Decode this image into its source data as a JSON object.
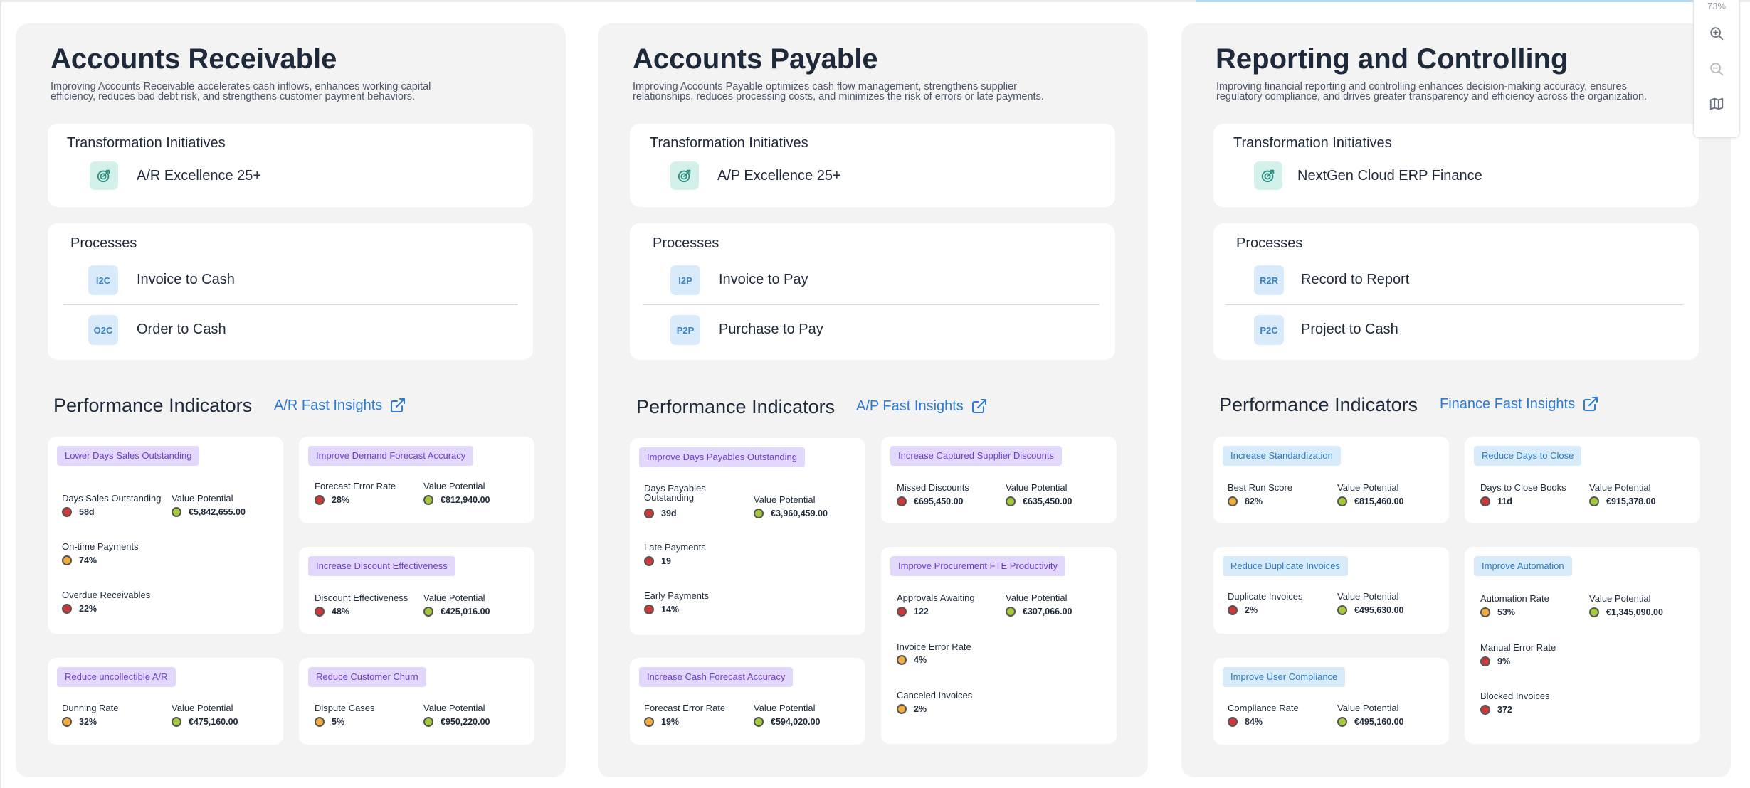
{
  "zoom": {
    "percent": "73%"
  },
  "columns": [
    {
      "title": "Accounts Receivable",
      "description_line1": "Improving Accounts Receivable accelerates cash inflows, enhances working capital",
      "description_line2": "efficiency, reduces bad debt risk, and strengthens customer payment behaviors.",
      "initiatives_title": "Transformation Initiatives",
      "initiative": "A/R Excellence 25+",
      "processes_title": "Processes",
      "processes": [
        {
          "code": "I2C",
          "name": "Invoice to Cash"
        },
        {
          "code": "O2C",
          "name": "Order to Cash"
        }
      ],
      "pi_title": "Performance Indicators",
      "pi_link": "A/R Fast Insights",
      "kpi_cards": [
        {
          "tag": "Lower Days Sales Outstanding",
          "value_label": "Value Potential",
          "value": "€5,842,655.00",
          "value_status": "green",
          "metrics": [
            {
              "label": "Days Sales Outstanding",
              "value": "58d",
              "status": "red"
            },
            {
              "label": "On-time Payments",
              "value": "74%",
              "status": "orange"
            },
            {
              "label": "Overdue Receivables",
              "value": "22%",
              "status": "red"
            }
          ]
        },
        {
          "tag": "Improve Demand Forecast Accuracy",
          "value_label": "Value Potential",
          "value": "€812,940.00",
          "value_status": "green",
          "metrics": [
            {
              "label": "Forecast Error Rate",
              "value": "28%",
              "status": "red"
            }
          ]
        },
        {
          "tag": "Increase Discount Effectiveness",
          "value_label": "Value Potential",
          "value": "€425,016.00",
          "value_status": "green",
          "metrics": [
            {
              "label": "Discount Effectiveness",
              "value": "48%",
              "status": "red"
            }
          ]
        },
        {
          "tag": "Reduce uncollectible A/R",
          "value_label": "Value Potential",
          "value": "€475,160.00",
          "value_status": "green",
          "metrics": [
            {
              "label": "Dunning Rate",
              "value": "32%",
              "status": "orange"
            }
          ]
        },
        {
          "tag": "Reduce Customer Churn",
          "value_label": "Value Potential",
          "value": "€950,220.00",
          "value_status": "green",
          "metrics": [
            {
              "label": "Dispute Cases",
              "value": "5%",
              "status": "orange"
            }
          ]
        }
      ]
    },
    {
      "title": "Accounts Payable",
      "description_line1": "Improving Accounts Payable optimizes cash flow management, strengthens supplier",
      "description_line2": "relationships, reduces processing costs, and minimizes the risk of errors or late payments.",
      "initiatives_title": "Transformation Initiatives",
      "initiative": "A/P Excellence 25+",
      "processes_title": "Processes",
      "processes": [
        {
          "code": "I2P",
          "name": "Invoice to Pay"
        },
        {
          "code": "P2P",
          "name": "Purchase to Pay"
        }
      ],
      "pi_title": "Performance Indicators",
      "pi_link": "A/P Fast Insights",
      "kpi_cards": [
        {
          "tag": "Improve Days Payables Outstanding",
          "value_label": "Value Potential",
          "value": "€3,960,459.00",
          "value_status": "green",
          "metrics": [
            {
              "label": "Days Payables",
              "label2": "Outstanding",
              "value": "39d",
              "status": "red"
            },
            {
              "label": "Late Payments",
              "value": "19",
              "status": "red"
            },
            {
              "label": "Early Payments",
              "value": "14%",
              "status": "red"
            }
          ]
        },
        {
          "tag": "Increase Captured Supplier Discounts",
          "value_label": "Value Potential",
          "value": "€635,450.00",
          "value_status": "green",
          "metrics": [
            {
              "label": "Missed Discounts",
              "value": "€695,450.00",
              "status": "red"
            }
          ]
        },
        {
          "tag": "Improve Procurement FTE Productivity",
          "value_label": "Value Potential",
          "value": "€307,066.00",
          "value_status": "green",
          "metrics": [
            {
              "label": "Approvals Awaiting",
              "value": "122",
              "status": "red"
            },
            {
              "label": "Invoice Error Rate",
              "value": "4%",
              "status": "orange"
            },
            {
              "label": "Canceled Invoices",
              "value": "2%",
              "status": "orange"
            }
          ]
        },
        {
          "tag": "Increase Cash Forecast Accuracy",
          "value_label": "Value Potential",
          "value": "€594,020.00",
          "value_status": "green",
          "metrics": [
            {
              "label": "Forecast Error Rate",
              "value": "19%",
              "status": "orange"
            }
          ]
        }
      ]
    },
    {
      "title": "Reporting and Controlling",
      "description_line1": "Improving financial reporting and controlling enhances decision-making accuracy, ensures",
      "description_line2": "regulatory compliance, and drives greater transparency and efficiency across the organization.",
      "initiatives_title": "Transformation Initiatives",
      "initiative": "NextGen Cloud ERP Finance",
      "processes_title": "Processes",
      "processes": [
        {
          "code": "R2R",
          "name": "Record to Report"
        },
        {
          "code": "P2C",
          "name": "Project to Cash"
        }
      ],
      "pi_title": "Performance Indicators",
      "pi_link": "Finance Fast Insights",
      "kpi_cards": [
        {
          "tag": "Increase Standardization",
          "value_label": "Value Potential",
          "value": "€815,460.00",
          "value_status": "green",
          "metrics": [
            {
              "label": "Best Run Score",
              "value": "82%",
              "status": "orange"
            }
          ]
        },
        {
          "tag": "Reduce Days to Close",
          "value_label": "Value Potential",
          "value": "€915,378.00",
          "value_status": "green",
          "metrics": [
            {
              "label": "Days to Close Books",
              "value": "11d",
              "status": "red"
            }
          ]
        },
        {
          "tag": "Reduce Duplicate Invoices",
          "value_label": "Value Potential",
          "value": "€495,630.00",
          "value_status": "green",
          "metrics": [
            {
              "label": "Duplicate Invoices",
              "value": "2%",
              "status": "red"
            }
          ]
        },
        {
          "tag": "Improve Automation",
          "value_label": "Value Potential",
          "value": "€1,345,090.00",
          "value_status": "green",
          "metrics": [
            {
              "label": "Automation Rate",
              "value": "53%",
              "status": "orange"
            },
            {
              "label": "Manual Error Rate",
              "value": "9%",
              "status": "red"
            },
            {
              "label": "Blocked Invoices",
              "value": "372",
              "status": "red"
            }
          ]
        },
        {
          "tag": "Improve User Compliance",
          "value_label": "Value Potential",
          "value": "€495,160.00",
          "value_status": "green",
          "metrics": [
            {
              "label": "Compliance Rate",
              "value": "84%",
              "status": "red"
            }
          ]
        }
      ]
    }
  ],
  "colors": {
    "red": "#cf3838",
    "orange": "#f0ad3c",
    "green": "#a4c93b",
    "link": "#2d7bd6",
    "tag_purple": "#e2d8fb",
    "tag_blue": "#d8ebfb"
  },
  "icons": {
    "initiative": "target-icon",
    "external_link": "external-link-icon",
    "zoom_in": "zoom-in-icon",
    "zoom_out": "zoom-out-icon",
    "map": "map-icon"
  }
}
